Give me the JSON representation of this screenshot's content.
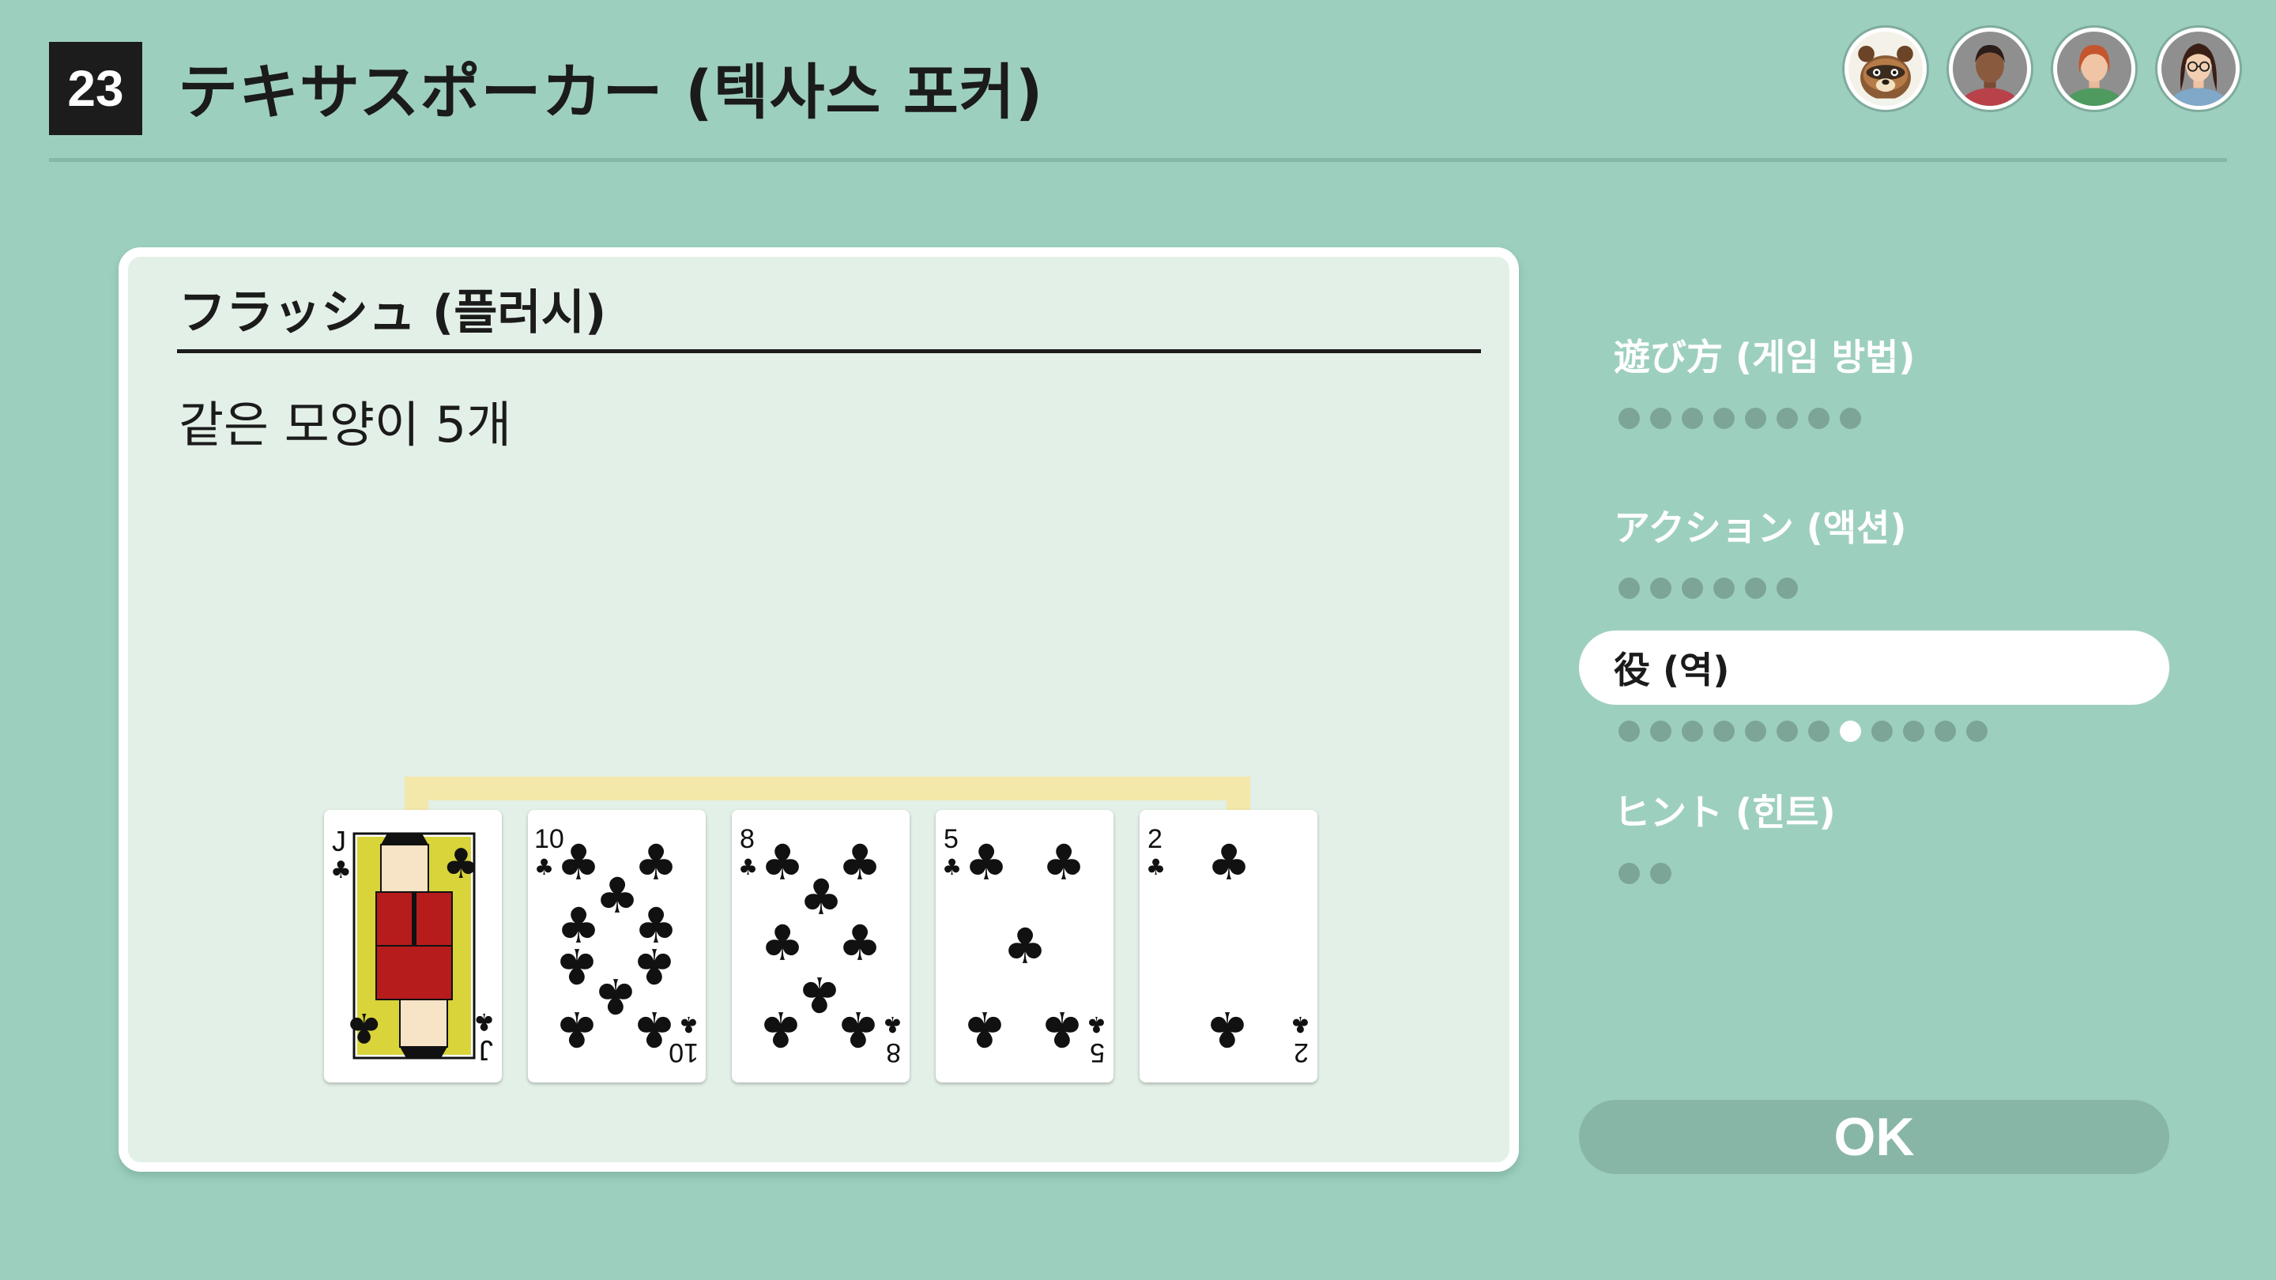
{
  "header": {
    "game_number": "23",
    "title": "テキサスポーカー (텍사스 포커)"
  },
  "players": [
    "raccoon-villager-avatar",
    "player-avatar-dark-hair",
    "player-avatar-red-hair",
    "player-avatar-glasses"
  ],
  "panel": {
    "hand_name": "フラッシュ (플러시)",
    "description": "같은 모양이 5개",
    "cards": [
      {
        "rank": "J",
        "suit": "clubs"
      },
      {
        "rank": "10",
        "suit": "clubs"
      },
      {
        "rank": "8",
        "suit": "clubs"
      },
      {
        "rank": "5",
        "suit": "clubs"
      },
      {
        "rank": "2",
        "suit": "clubs"
      }
    ]
  },
  "menu": {
    "items": [
      {
        "label": "遊び方 (게임 방법)",
        "pages": 8,
        "current": null,
        "active": false
      },
      {
        "label": "アクション (액션)",
        "pages": 6,
        "current": null,
        "active": false
      },
      {
        "label": "役 (역)",
        "pages": 12,
        "current": 7,
        "active": true
      },
      {
        "label": "ヒント (힌트)",
        "pages": 2,
        "current": null,
        "active": false
      }
    ]
  },
  "ok_label": "OK",
  "colors": {
    "background": "#9dcfbf",
    "panel": "#e3f0e7",
    "highlight_bracket": "#f3e7a9",
    "dot_inactive": "#7ca598",
    "ok_button": "#88b6a6"
  }
}
